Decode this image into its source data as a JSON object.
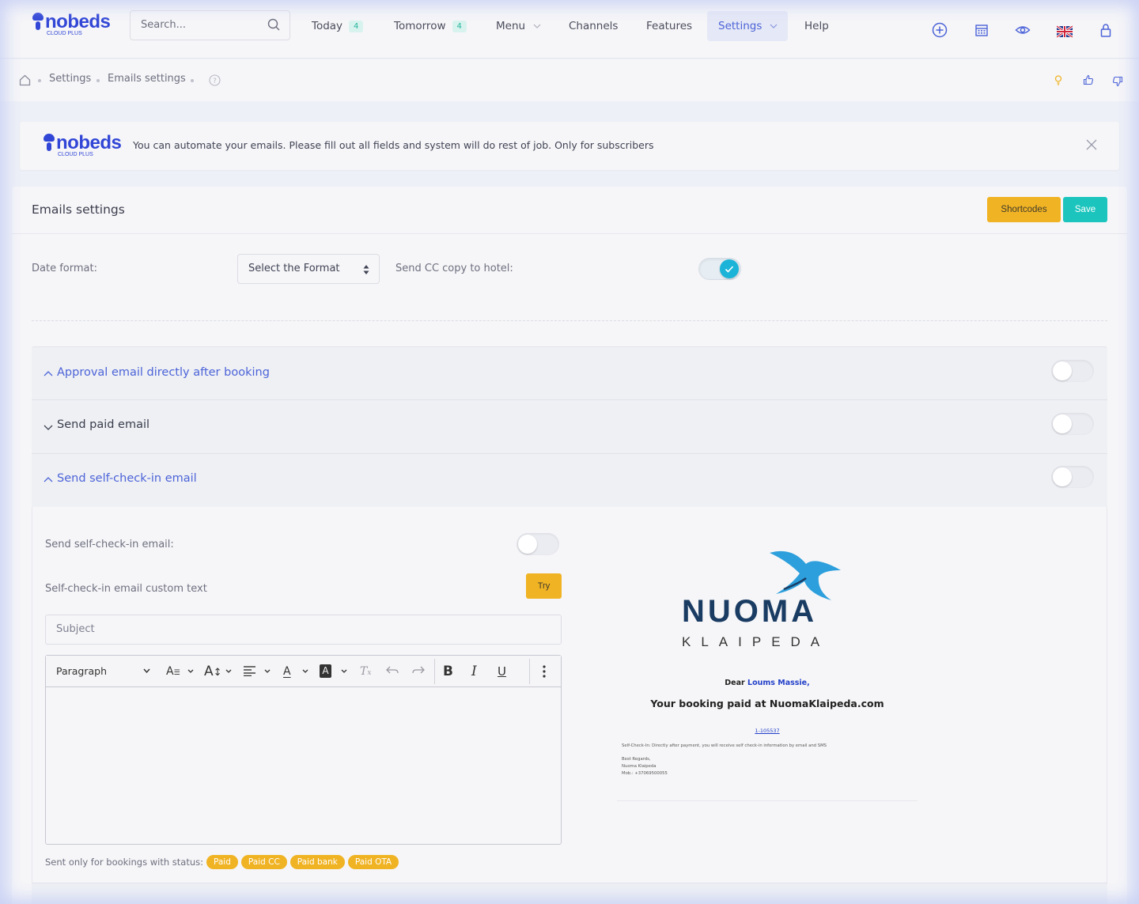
{
  "brand": {
    "name": "nobeds",
    "tagline": "CLOUD PLUS"
  },
  "search": {
    "placeholder": "Search..."
  },
  "nav": {
    "today": {
      "label": "Today",
      "count": "4"
    },
    "tomorrow": {
      "label": "Tomorrow",
      "count": "4"
    },
    "menu": "Menu",
    "channels": "Channels",
    "features": "Features",
    "settings": "Settings",
    "help": "Help"
  },
  "breadcrumb": {
    "items": [
      "Settings",
      "Emails settings"
    ]
  },
  "alert": {
    "message": "You can automate your emails. Please fill out all fields and system will do rest of job. Only for subscribers"
  },
  "page": {
    "title": "Emails settings",
    "shortcodes_label": "Shortcodes",
    "save_label": "Save",
    "date_format_label": "Date format:",
    "date_format_value": "Select the Format",
    "cc_label": "Send CC copy to hotel:",
    "cc_on": true
  },
  "accordion": [
    {
      "title": "Approval email directly after booking",
      "expanded": true,
      "enabled": false
    },
    {
      "title": "Send paid email",
      "expanded": false,
      "enabled": false
    },
    {
      "title": "Send self-check-in email",
      "expanded": true,
      "enabled": false
    }
  ],
  "selfcheckin": {
    "send_label": "Send self-check-in email:",
    "custom_text_label": "Self-check-in email custom text",
    "try_label": "Try",
    "subject_placeholder": "Subject",
    "status_label": "Sent only for bookings with status:",
    "statuses": [
      "Paid",
      "Paid CC",
      "Paid bank",
      "Paid OTA"
    ]
  },
  "editor": {
    "block_format": "Paragraph"
  },
  "preview": {
    "logo_word": "NUOMA",
    "logo_sub": "KLAIPEDA",
    "greeting": "Dear",
    "guest": "Loums Massie,",
    "headline": "Your booking paid at NuomaKlaipeda.com",
    "booking_link": "1-105537",
    "body": "Self-Check-In: Directly after payment, you will receive self check-in information by email and SMS",
    "regards": "Best Regards,",
    "company": "Nuoma Klaipeda",
    "phone": "Mob.: +37069500055"
  },
  "colors": {
    "brand": "#3146d6",
    "accent_yellow": "#f0b324",
    "accent_teal": "#1bc5bd",
    "toggle_on": "#1bb4d8",
    "link": "#4c63d8"
  }
}
